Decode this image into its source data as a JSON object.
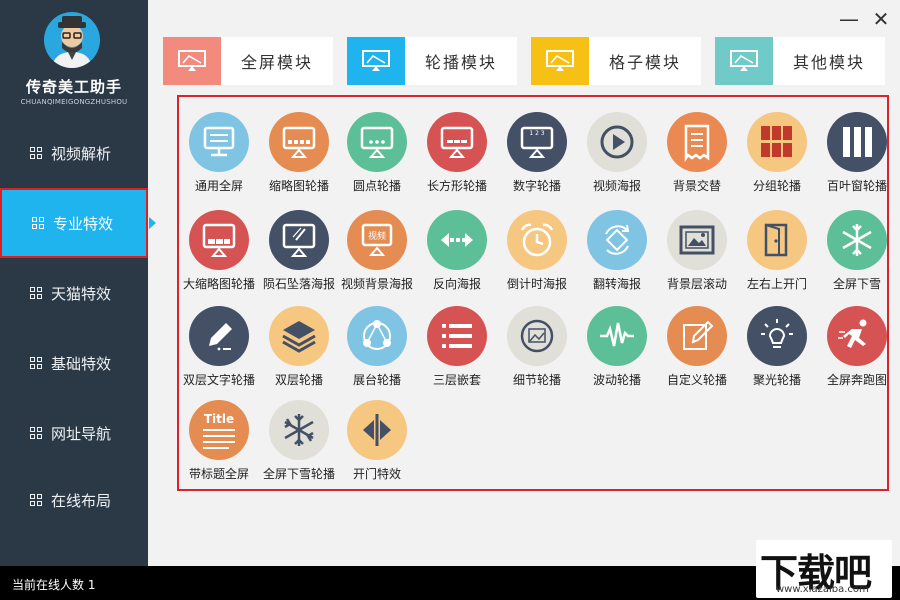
{
  "window": {
    "minimize_icon": "minimize-icon",
    "close_icon": "close-icon",
    "minimize_glyph": "—",
    "close_glyph": "✕"
  },
  "brand": {
    "title": "传奇美工助手",
    "subtitle": "CHUANQIMEIGONGZHUSHOU"
  },
  "sidebar": {
    "items": [
      {
        "label": "视频解析",
        "active": false
      },
      {
        "label": "专业特效",
        "active": true
      },
      {
        "label": "天猫特效",
        "active": false
      },
      {
        "label": "基础特效",
        "active": false
      },
      {
        "label": "网址导航",
        "active": false
      },
      {
        "label": "在线布局",
        "active": false
      }
    ]
  },
  "tabs": [
    {
      "label": "全屏模块",
      "color": "#f28b7e"
    },
    {
      "label": "轮播模块",
      "color": "#1fb4ee"
    },
    {
      "label": "格子模块",
      "color": "#f7c014"
    },
    {
      "label": "其他模块",
      "color": "#6fcac8"
    }
  ],
  "effects": [
    {
      "label": "通用全屏",
      "color": "#7fc4e3",
      "icon": "monitor"
    },
    {
      "label": "缩略图轮播",
      "color": "#e48c52",
      "icon": "thumb-slider"
    },
    {
      "label": "圆点轮播",
      "color": "#5dbf97",
      "icon": "dot-slider"
    },
    {
      "label": "长方形轮播",
      "color": "#d65353",
      "icon": "rect-slider"
    },
    {
      "label": "数字轮播",
      "color": "#445066",
      "icon": "number-slider"
    },
    {
      "label": "视频海报",
      "color": "#e0e0d8",
      "icon": "play"
    },
    {
      "label": "背景交替",
      "color": "#ea8a52",
      "icon": "document"
    },
    {
      "label": "分组轮播",
      "color": "#f5c781",
      "icon": "group-grid"
    },
    {
      "label": "百叶窗轮播",
      "color": "#445066",
      "icon": "blinds"
    },
    {
      "label": "大缩略图轮播",
      "color": "#d65353",
      "icon": "big-thumb"
    },
    {
      "label": "陨石坠落海报",
      "color": "#445066",
      "icon": "meteor"
    },
    {
      "label": "视频背景海报",
      "color": "#e48c52",
      "icon": "video-bg",
      "text": "视频"
    },
    {
      "label": "反向海报",
      "color": "#5dbf97",
      "icon": "reverse-arrows"
    },
    {
      "label": "倒计时海报",
      "color": "#f5c781",
      "icon": "alarm-clock"
    },
    {
      "label": "翻转海报",
      "color": "#7fc4e3",
      "icon": "rotate"
    },
    {
      "label": "背景层滚动",
      "color": "#e0e0d8",
      "icon": "image-frame"
    },
    {
      "label": "左右上开门",
      "color": "#f5c781",
      "icon": "door"
    },
    {
      "label": "全屏下雪",
      "color": "#5dbf97",
      "icon": "snowflake"
    },
    {
      "label": "双层文字轮播",
      "color": "#445066",
      "icon": "pencil"
    },
    {
      "label": "双层轮播",
      "color": "#f5c781",
      "icon": "layers"
    },
    {
      "label": "展台轮播",
      "color": "#7fc4e3",
      "icon": "share-nodes"
    },
    {
      "label": "三层嵌套",
      "color": "#d65353",
      "icon": "list"
    },
    {
      "label": "细节轮播",
      "color": "#e0e0d8",
      "icon": "image-circle"
    },
    {
      "label": "波动轮播",
      "color": "#5dbf97",
      "icon": "pulse"
    },
    {
      "label": "自定义轮播",
      "color": "#e48c52",
      "icon": "edit"
    },
    {
      "label": "聚光轮播",
      "color": "#445066",
      "icon": "bulb"
    },
    {
      "label": "全屏奔跑图",
      "color": "#d65353",
      "icon": "runner"
    },
    {
      "label": "带标题全屏",
      "color": "#e48c52",
      "icon": "title",
      "text": "Title"
    },
    {
      "label": "全屏下雪轮播",
      "color": "#e0e0d8",
      "icon": "snowflake-dark"
    },
    {
      "label": "开门特效",
      "color": "#f5c781",
      "icon": "split-door"
    }
  ],
  "status": {
    "online_text": "当前在线人数 1"
  },
  "watermark": {
    "main": "下载吧",
    "sub": "www.xiazaiba.com"
  }
}
